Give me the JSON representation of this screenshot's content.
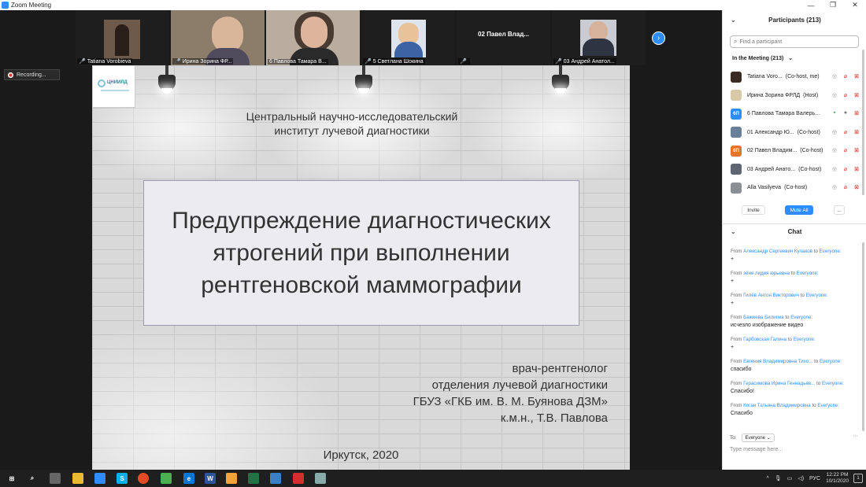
{
  "window": {
    "title": "Zoom Meeting"
  },
  "video_strip": {
    "tiles": [
      {
        "name": "Tatiana Vorobieva",
        "muted": true,
        "active": false
      },
      {
        "name": "Ирина Зорина ФР...",
        "muted": true,
        "active": false
      },
      {
        "name": "6 Павлова Тамара В...",
        "muted": false,
        "active": true
      },
      {
        "name": "5 Светлана Шокина",
        "muted": true,
        "active": false
      },
      {
        "name": "",
        "muted": true,
        "active": false,
        "big_label": "02  Павел Влад..."
      },
      {
        "name": "03 Андрей Анатол...",
        "muted": true,
        "active": false
      }
    ]
  },
  "recording": {
    "label": "Recording..."
  },
  "slide": {
    "institute_line1": "Центральный научно-исследовательский",
    "institute_line2": "институт лучевой диагностики",
    "logo_text": "ЦНИИЛД",
    "title": "Предупреждение диагностических ятрогений при выполнении рентгеновской маммографии",
    "author_line1": "врач-рентгенолог",
    "author_line2": "отделения лучевой диагностики",
    "author_line3": "ГБУЗ «ГКБ им. В. М. Буянова ДЗМ»",
    "author_line4": "к.м.н., Т.В. Павлова",
    "city_year": "Иркутск, 2020"
  },
  "participants_panel": {
    "header": "Participants (213)",
    "search_placeholder": "Find a participant",
    "in_meeting": "In the Meeting (213)",
    "participants": [
      {
        "avatar_text": "",
        "avatar_color": "#3b2a22",
        "name": "Tatiana Voro...",
        "role": "(Co-host, me)",
        "video_on": false,
        "mic": "muted"
      },
      {
        "avatar_text": "",
        "avatar_color": "#d8c9a8",
        "name": "Ирина Зорина ФРЛД",
        "role": "(Host)",
        "video_on": false,
        "mic": "muted"
      },
      {
        "avatar_text": "6П",
        "avatar_color": "#2d8cff",
        "name": "6 Павлова Тамара Валерь...",
        "role": "",
        "video_on": true,
        "mic": "on"
      },
      {
        "avatar_text": "",
        "avatar_color": "#6a7f98",
        "name": "01 Александр Ю...",
        "role": "(Co-host)",
        "video_on": false,
        "mic": "muted"
      },
      {
        "avatar_text": "0П",
        "avatar_color": "#e8732c",
        "name": "02 Павел Владим...",
        "role": "(Co-host)",
        "video_on": false,
        "mic": "muted"
      },
      {
        "avatar_text": "",
        "avatar_color": "#5d6672",
        "name": "03 Андрей Анато...",
        "role": "(Co-host)",
        "video_on": false,
        "mic": "muted"
      },
      {
        "avatar_text": "",
        "avatar_color": "#8a8f96",
        "name": "Alla Vasilyeva",
        "role": "(Co-host)",
        "video_on": false,
        "mic": "muted"
      }
    ],
    "invite_label": "Invite",
    "mute_all_label": "Mute All",
    "more_label": "..."
  },
  "chat": {
    "header": "Chat",
    "messages": [
      {
        "from": "Александр Сергеевич  Кулаков",
        "to": "Everyone",
        "text": "+"
      },
      {
        "from": "зёне лидия юрьевна",
        "to": "Everyone",
        "text": "+"
      },
      {
        "from": "Гилёв Антон Викторович",
        "to": "Everyone",
        "text": "+"
      },
      {
        "from": "Бажеева Билигма",
        "to": "Everyone",
        "text": "исчезло изображение видео"
      },
      {
        "from": "Гарбовская Галина",
        "to": "Everyone",
        "text": "+"
      },
      {
        "from": "Евгения Владимировна Тихо...",
        "to": "Everyone",
        "text": "спасибо"
      },
      {
        "from": "Герасимова Ирина Геннадьев...",
        "to": "Everyone",
        "text": "Спасибо!"
      },
      {
        "from": "Коган Татьяна Владимировна",
        "to": "Everyone",
        "text": "Спасибо"
      }
    ],
    "from_prefix": "From",
    "to_word": "to",
    "to_label": "To:",
    "recipient": "Everyone",
    "input_placeholder": "Type message here...",
    "more_label": "···"
  },
  "taskbar": {
    "language": "РУС",
    "time": "12:22 PM",
    "date": "10/1/2020",
    "notification_count": "1"
  }
}
